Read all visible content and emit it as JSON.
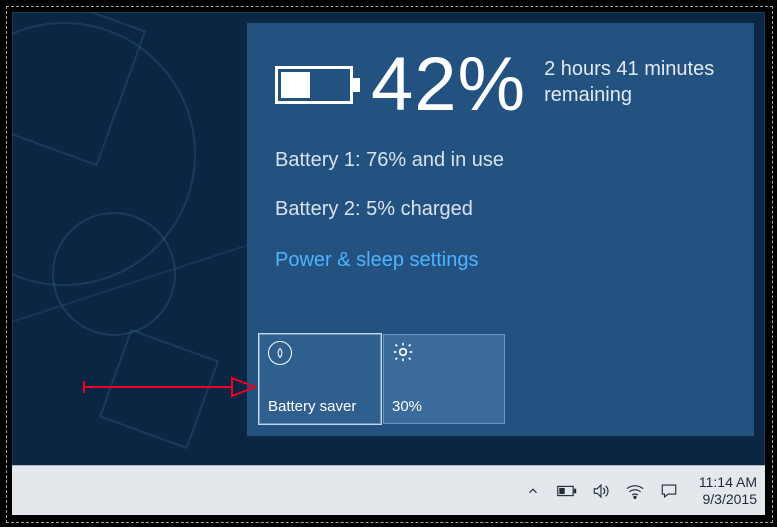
{
  "flyout": {
    "percent": "42%",
    "remaining_line1": "2 hours 41 minutes",
    "remaining_line2": "remaining",
    "battery1": "Battery 1: 76% and in use",
    "battery2": "Battery 2: 5% charged",
    "link": "Power & sleep settings",
    "tiles": {
      "battery_saver": {
        "label": "Battery saver"
      },
      "brightness": {
        "label": "30%"
      }
    }
  },
  "tray": {
    "time": "11:14 AM",
    "date": "9/3/2015"
  }
}
